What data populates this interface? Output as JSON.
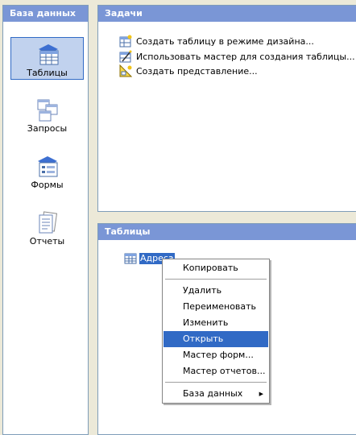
{
  "left_panel": {
    "title": "База данных",
    "items": [
      {
        "label": "Таблицы",
        "icon": "tables-icon",
        "selected": true
      },
      {
        "label": "Запросы",
        "icon": "queries-icon",
        "selected": false
      },
      {
        "label": "Формы",
        "icon": "forms-icon",
        "selected": false
      },
      {
        "label": "Отчеты",
        "icon": "reports-icon",
        "selected": false
      }
    ]
  },
  "tasks_panel": {
    "title": "Задачи",
    "tasks": [
      {
        "label": "Создать таблицу в режиме дизайна...",
        "icon": "table-design-icon"
      },
      {
        "label": "Использовать мастер для создания таблицы...",
        "icon": "table-wizard-icon"
      },
      {
        "label": "Создать представление...",
        "icon": "create-view-icon"
      }
    ]
  },
  "tables_panel": {
    "title": "Таблицы",
    "items": [
      {
        "label": "Адреса",
        "icon": "table-icon",
        "selected": true
      }
    ]
  },
  "context_menu": {
    "items": [
      {
        "label": "Копировать",
        "highlighted": false
      },
      {
        "label": "Удалить",
        "highlighted": false
      },
      {
        "label": "Переименовать",
        "highlighted": false
      },
      {
        "label": "Изменить",
        "highlighted": false
      },
      {
        "label": "Открыть",
        "highlighted": true
      },
      {
        "label": "Мастер форм...",
        "highlighted": false
      },
      {
        "label": "Мастер отчетов...",
        "highlighted": false
      },
      {
        "label": "База данных",
        "highlighted": false,
        "submenu": true
      }
    ]
  },
  "colors": {
    "header": "#7a96d6",
    "selection": "#316ac5",
    "selected_item_bg": "#c1d2ee",
    "background": "#ece9d8"
  }
}
